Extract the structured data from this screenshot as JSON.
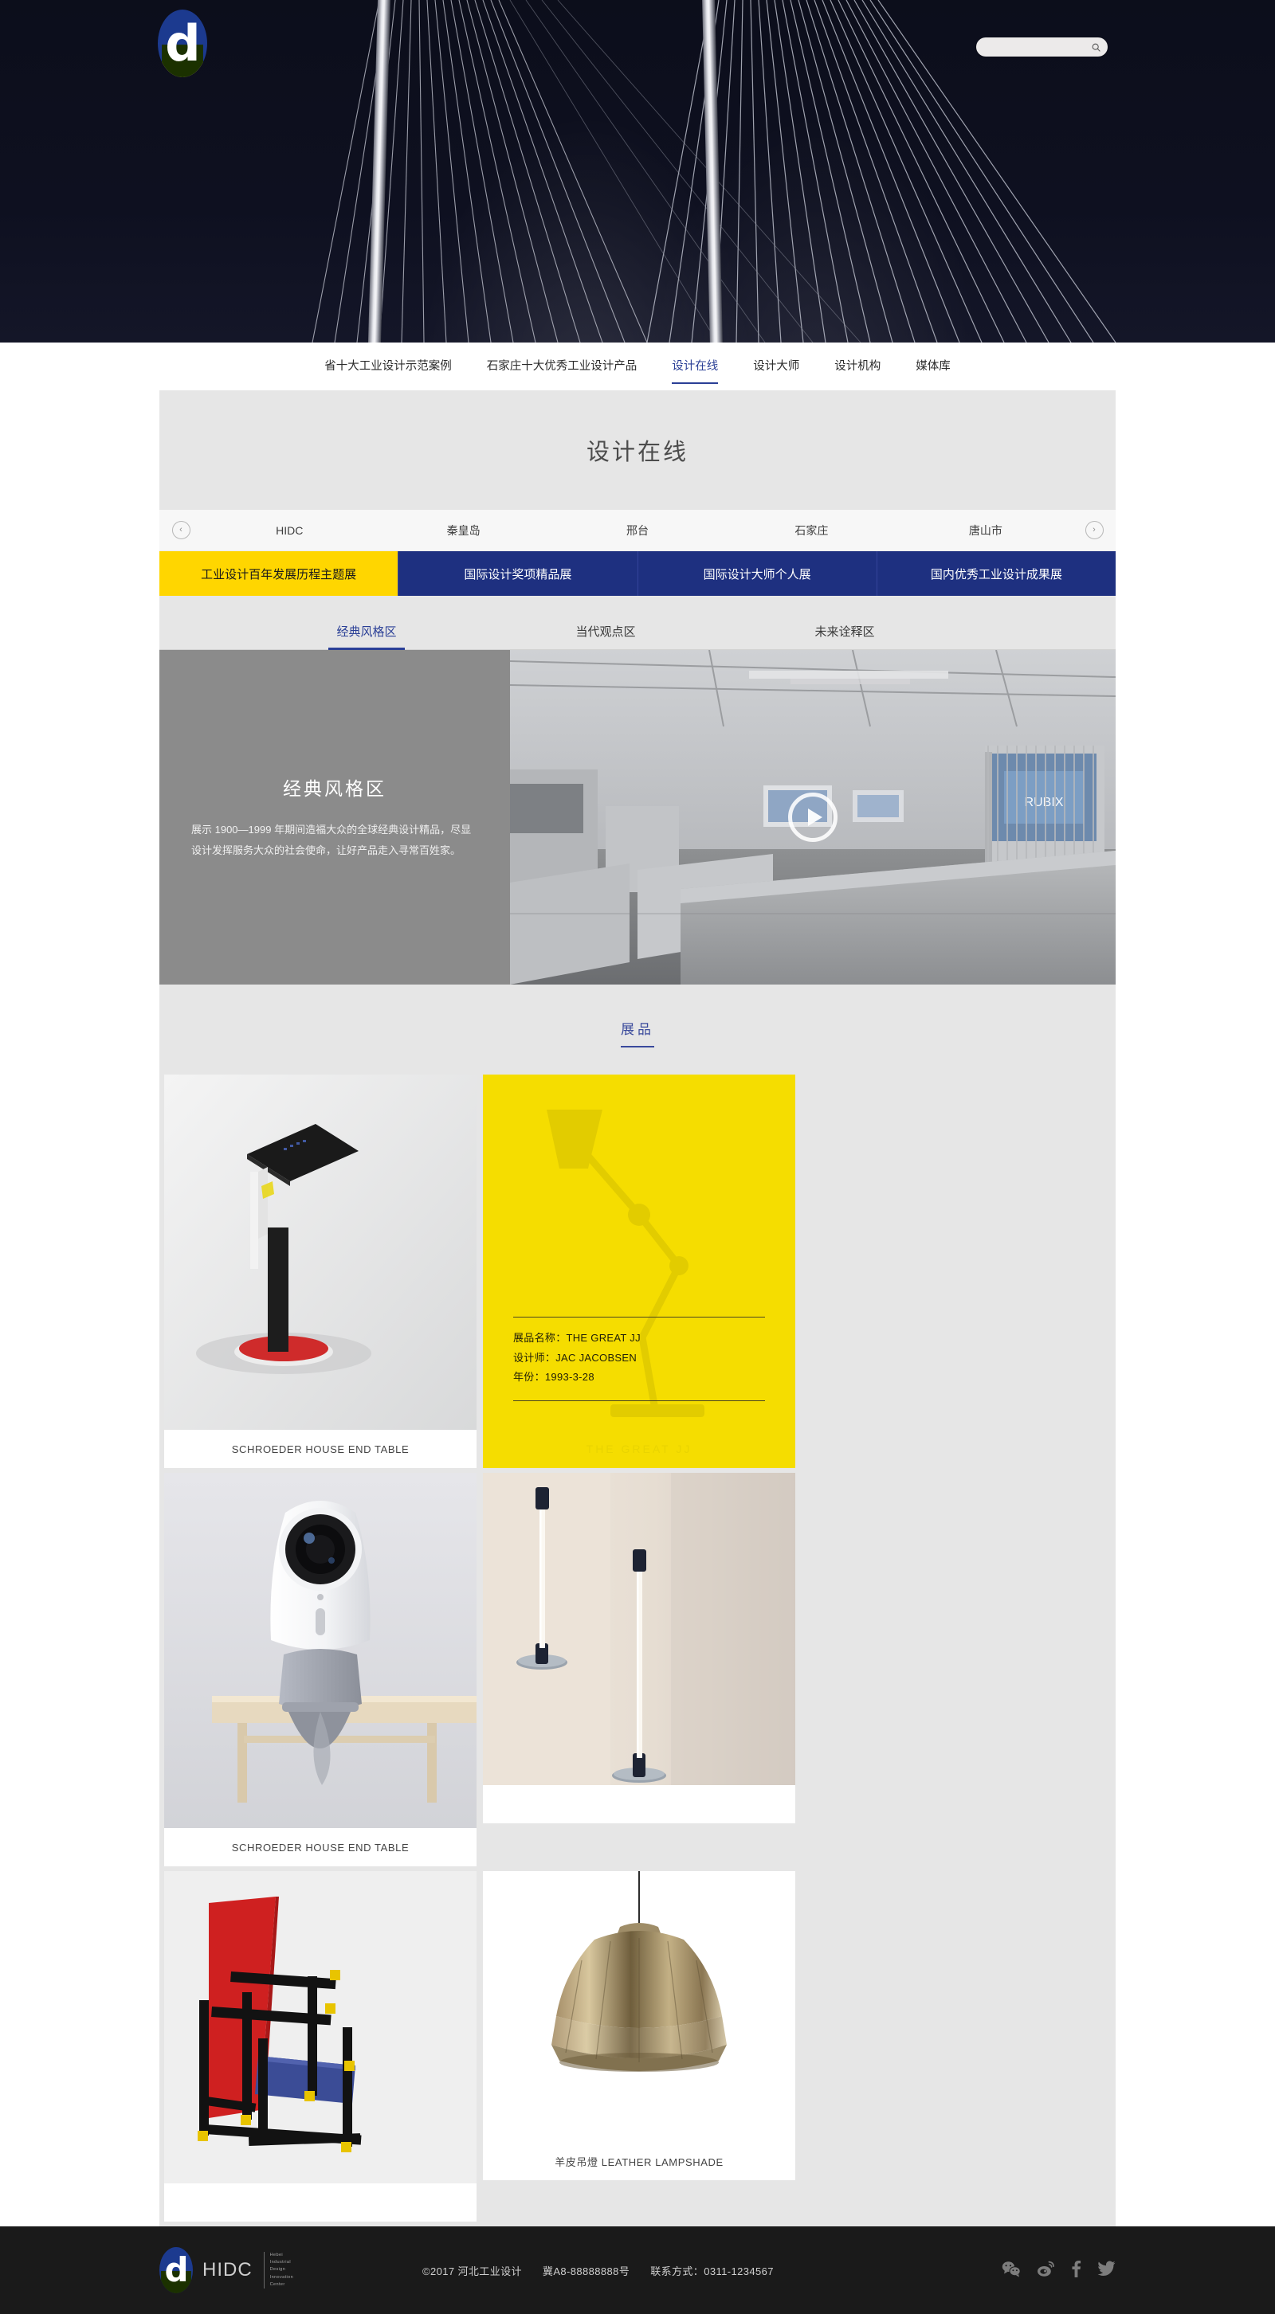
{
  "header": {
    "logo_alt": "HIDC logo",
    "search": {
      "value": "",
      "placeholder": ""
    }
  },
  "nav": {
    "items": [
      {
        "label": "省十大工业设计示范案例",
        "active": false
      },
      {
        "label": "石家庄十大优秀工业设计产品",
        "active": false
      },
      {
        "label": "设计在线",
        "active": true
      },
      {
        "label": "设计大师",
        "active": false
      },
      {
        "label": "设计机构",
        "active": false
      },
      {
        "label": "媒体库",
        "active": false
      }
    ]
  },
  "page": {
    "title": "设计在线"
  },
  "cities": {
    "prev_label": "‹",
    "next_label": "›",
    "items": [
      "HIDC",
      "秦皇岛",
      "邢台",
      "石家庄",
      "唐山市"
    ]
  },
  "exhibitions": {
    "tabs": [
      {
        "label": "工业设计百年发展历程主题展",
        "active": true
      },
      {
        "label": "国际设计奖项精品展",
        "active": false
      },
      {
        "label": "国际设计大师个人展",
        "active": false
      },
      {
        "label": "国内优秀工业设计成果展",
        "active": false
      }
    ],
    "active_color": "#ffd600",
    "base_color": "#1e3080"
  },
  "zones": {
    "tabs": [
      {
        "label": "经典风格区",
        "active": true
      },
      {
        "label": "当代观点区",
        "active": false
      },
      {
        "label": "未来诠释区",
        "active": false
      }
    ]
  },
  "banner": {
    "title": "经典风格区",
    "description": "展示 1900—1999 年期间造福大众的全球经典设计精品，尽显设计发挥服务大众的社会使命，让好产品走入寻常百姓家。",
    "play_label": "播放"
  },
  "exhibits": {
    "section_title": "展品",
    "cards": [
      {
        "kind": "photo",
        "art": "side-table",
        "caption": "SCHROEDER HOUSE END TABLE"
      },
      {
        "kind": "feature",
        "art": "desk-lamp",
        "fields": [
          "展品名称：THE GREAT JJ",
          "设计师：JAC JACOBSEN",
          "年份：1993-3-28"
        ],
        "watermark": "THE GREAT JJ",
        "bg_color": "#f5dd00"
      },
      {
        "kind": "photo",
        "art": "camera",
        "caption": "SCHROEDER HOUSE END TABLE"
      },
      {
        "kind": "photo",
        "art": "floor-lamps",
        "caption": ""
      },
      {
        "kind": "photo",
        "art": "red-blue-chair",
        "caption": ""
      },
      {
        "kind": "photo",
        "art": "pendant-lamp",
        "caption": "羊皮吊燈 LEATHER LAMPSHADE"
      }
    ]
  },
  "footer": {
    "brand": "HIDC",
    "brand_sub": "Hebei\nIndustrial\nDesign\nInnovation\nCenter",
    "copyright": "©2017 河北工业设计",
    "icp": "冀A8-88888888号",
    "contact": "联系方式：0311-1234567",
    "social": [
      "wechat-icon",
      "weibo-icon",
      "facebook-icon",
      "twitter-icon"
    ]
  }
}
